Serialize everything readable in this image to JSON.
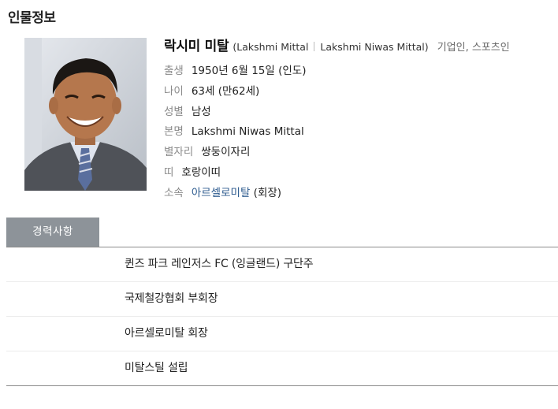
{
  "header": {
    "title": "인물정보"
  },
  "profile": {
    "name_ko": "락시미 미탈",
    "name_en": "(Lakshmi Mittal",
    "name_full": "Lakshmi Niwas Mittal)",
    "occupation": "기업인, 스포츠인",
    "fields": [
      {
        "label": "출생",
        "value": "1950년 6월 15일 (인도)"
      },
      {
        "label": "나이",
        "value": "63세 (만62세)"
      },
      {
        "label": "성별",
        "value": "남성"
      },
      {
        "label": "본명",
        "value": "Lakshmi Niwas Mittal"
      },
      {
        "label": "별자리",
        "value": "쌍둥이자리"
      },
      {
        "label": "띠",
        "value": "호랑이띠"
      },
      {
        "label": "소속",
        "value": "아르셀로미탈",
        "extra": "(회장)"
      }
    ]
  },
  "tabs": [
    {
      "label": "경력사항"
    }
  ],
  "career": [
    "퀸즈 파크 레인저스 FC (잉글랜드) 구단주",
    "국제철강협회 부회장",
    "아르셀로미탈 회장",
    "미탈스틸 설립"
  ]
}
